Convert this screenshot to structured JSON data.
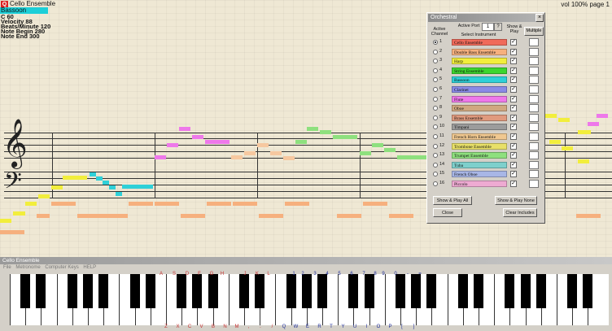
{
  "app": {
    "title": "Cello Ensemble",
    "instrument_highlight": "Bassoon",
    "info_lines": [
      "C  60",
      "Velocity 88",
      "Beats/Minute 120",
      "Note Begin 280",
      "Note End 300"
    ],
    "volume": "vol 100%",
    "page": "page 1"
  },
  "orchestral_dialog": {
    "title": "Orchestral",
    "active_port_label": "Active Port",
    "active_port_value": "1",
    "active_port_button": "?",
    "active_channel_label": "Active Channel",
    "select_instrument_label": "Select Instrument",
    "show_play_label": "Show & Play",
    "multiple_label": "Multiple",
    "channels": [
      {
        "num": "1",
        "name": "Cello Ensemble",
        "color": "#f06a5a",
        "selected": true,
        "show": "✓"
      },
      {
        "num": "2",
        "name": "Double Bass Ensemble",
        "color": "#f6b07e",
        "selected": false,
        "show": "✓"
      },
      {
        "num": "3",
        "name": "Harp",
        "color": "#f2ee3c",
        "selected": false,
        "show": "✓"
      },
      {
        "num": "4",
        "name": "String Ensemble",
        "color": "#3cd62e",
        "selected": false,
        "show": "✓"
      },
      {
        "num": "5",
        "name": "Bassoon",
        "color": "#2ed0d8",
        "selected": false,
        "show": "✓"
      },
      {
        "num": "6",
        "name": "Clarinet",
        "color": "#8a8ae6",
        "selected": false,
        "show": "✓"
      },
      {
        "num": "7",
        "name": "Flute",
        "color": "#ee78ea",
        "selected": false,
        "show": "✓"
      },
      {
        "num": "8",
        "name": "Oboe",
        "color": "#d0a880",
        "selected": false,
        "show": "✓"
      },
      {
        "num": "9",
        "name": "Brass Ensemble",
        "color": "#e09a7e",
        "selected": false,
        "show": "✓"
      },
      {
        "num": "10",
        "name": "Timpani",
        "color": "#9c9c9c",
        "selected": false,
        "show": "✓"
      },
      {
        "num": "11",
        "name": "French Horn Ensemble",
        "color": "#f0c890",
        "selected": false,
        "show": "✓"
      },
      {
        "num": "12",
        "name": "Trombone Ensemble",
        "color": "#e8e068",
        "selected": false,
        "show": "✓"
      },
      {
        "num": "13",
        "name": "Trumpet Ensemble",
        "color": "#8ee07e",
        "selected": false,
        "show": "✓"
      },
      {
        "num": "14",
        "name": "Tuba",
        "color": "#7ed0cc",
        "selected": false,
        "show": "✓"
      },
      {
        "num": "15",
        "name": "French Oboe",
        "color": "#a8b6e6",
        "selected": false,
        "show": "✓"
      },
      {
        "num": "16",
        "name": "Piccolo",
        "color": "#eeaad2",
        "selected": false,
        "show": "✓"
      }
    ],
    "buttons": {
      "show_play_all": "Show & Play All",
      "show_play_none": "Show & Play None",
      "close": "Close",
      "clear_includes": "Clear Includes"
    }
  },
  "keyboard_window": {
    "title": "Cello Ensemble",
    "menu": [
      "File",
      "Metronome",
      "Computer Keys",
      "HELP"
    ],
    "upper_key_labels": [
      "A",
      "S",
      "D",
      "F",
      "G",
      "H",
      "J",
      "K",
      "L",
      "1",
      "2",
      "3",
      "4",
      "5",
      "6",
      "7",
      "8",
      "9",
      "0",
      "-",
      "="
    ],
    "lower_key_labels": [
      "Z",
      "X",
      "C",
      "V",
      "B",
      "N",
      "M",
      ",",
      ".",
      "/",
      "Q",
      "W",
      "E",
      "R",
      "T",
      "Y",
      "U",
      "I",
      "O",
      "P",
      "[",
      "]"
    ]
  },
  "colors": {
    "background": "#efe8d4",
    "dialog": "#d4d0c8",
    "highlight": "#1ccfd8"
  }
}
